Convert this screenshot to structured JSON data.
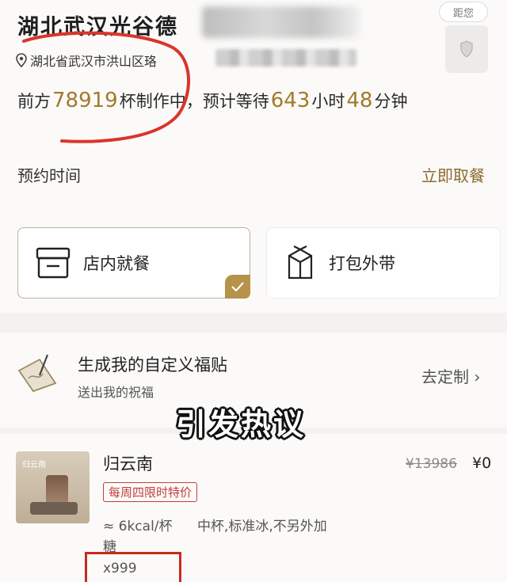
{
  "store": {
    "name": "湖北武汉光谷德",
    "address": "湖北省武汉市洪山区珞",
    "distance_label": "距您"
  },
  "queue": {
    "prefix": "前方",
    "cups": "78919",
    "middle": "杯制作中，预计等待",
    "hours": "643",
    "hour_unit": "小时",
    "minutes": "48",
    "minute_unit": "分钟"
  },
  "reservation": {
    "label": "预约时间",
    "action": "立即取餐"
  },
  "dining_options": {
    "dine_in": "店内就餐",
    "takeaway": "打包外带",
    "selected": "dine_in"
  },
  "blessing": {
    "title": "生成我的自定义福贴",
    "subtitle": "送出我的祝福",
    "action": "去定制 ›"
  },
  "overlay_caption": "引发热议",
  "product": {
    "name": "归云南",
    "badge": "每周四限时特价",
    "original_price": "¥13986",
    "price": "¥0",
    "kcal": "≈ 6kcal/杯",
    "options_line1": "中杯,标准冰,不另外加",
    "options_line2": "糖",
    "quantity": "x999",
    "image_tag": "归云南"
  },
  "colors": {
    "accent_gold": "#a27a2c",
    "check_gold": "#b6924a",
    "annotation_red": "#c62a22",
    "promo_red": "#c0403f"
  }
}
